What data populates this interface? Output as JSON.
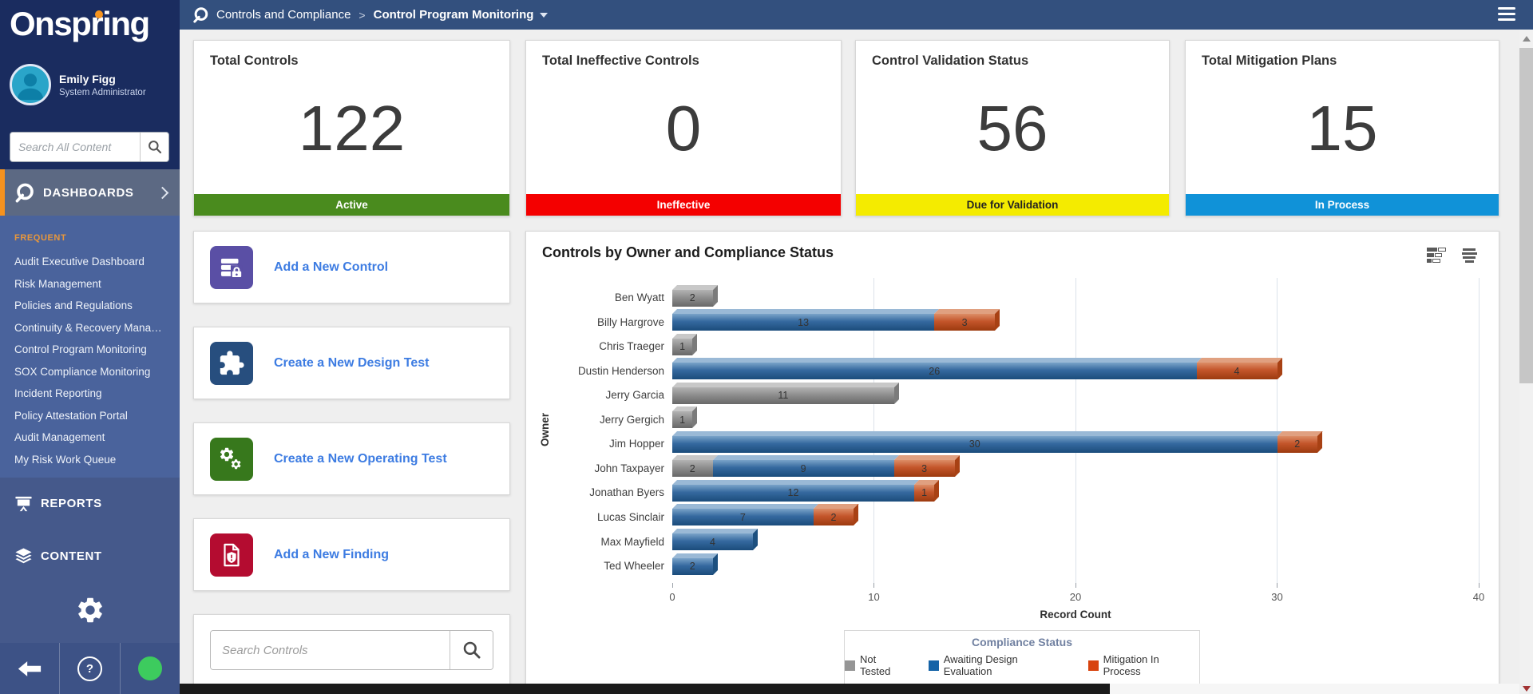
{
  "sidebar": {
    "logo": "Onspring",
    "user": {
      "name": "Emily Figg",
      "role": "System Administrator"
    },
    "search_placeholder": "Search All Content",
    "sections": {
      "dashboards": "DASHBOARDS",
      "reports": "REPORTS",
      "content": "CONTENT"
    },
    "frequent_label": "FREQUENT",
    "frequent_items": [
      "Audit Executive Dashboard",
      "Risk Management",
      "Policies and Regulations",
      "Continuity & Recovery Manag...",
      "Control Program Monitoring",
      "SOX Compliance Monitoring",
      "Incident Reporting",
      "Policy Attestation Portal",
      "Audit Management",
      "My Risk Work Queue"
    ]
  },
  "header": {
    "app": "Controls and Compliance",
    "separator": ">",
    "page": "Control Program Monitoring"
  },
  "footer": {
    "help_glyph": "?"
  },
  "kpis": [
    {
      "title": "Total Controls",
      "value": "122",
      "banner": "Active",
      "banner_color": "#4a8b1e",
      "banner_text_color": "#ffffff"
    },
    {
      "title": "Total Ineffective Controls",
      "value": "0",
      "banner": "Ineffective",
      "banner_color": "#f40000",
      "banner_text_color": "#ffffff"
    },
    {
      "title": "Control Validation Status",
      "value": "56",
      "banner": "Due for Validation",
      "banner_color": "#f4eb00",
      "banner_text_color": "#222222"
    },
    {
      "title": "Total Mitigation Plans",
      "value": "15",
      "banner": "In Process",
      "banner_color": "#1092d8",
      "banner_text_color": "#ffffff"
    }
  ],
  "quick_actions": [
    {
      "label": "Add a New Control",
      "icon": "control-stack-lock-icon",
      "tile_color": "#5a4fa5"
    },
    {
      "label": "Create a New Design Test",
      "icon": "puzzle-icon",
      "tile_color": "#274e7e"
    },
    {
      "label": "Create a New Operating Test",
      "icon": "gears-icon",
      "tile_color": "#37781c"
    },
    {
      "label": "Add a New Finding",
      "icon": "document-shield-icon",
      "tile_color": "#b40c30"
    }
  ],
  "controls_search": {
    "placeholder": "Search Controls"
  },
  "chart_data": {
    "type": "bar",
    "orientation": "horizontal",
    "stacked": true,
    "title": "Controls by Owner and Compliance Status",
    "categories": [
      "Ben Wyatt",
      "Billy Hargrove",
      "Chris Traeger",
      "Dustin Henderson",
      "Jerry Garcia",
      "Jerry Gergich",
      "Jim Hopper",
      "John Taxpayer",
      "Jonathan Byers",
      "Lucas Sinclair",
      "Max Mayfield",
      "Ted Wheeler"
    ],
    "series": [
      {
        "name": "Not Tested",
        "color": "#959595",
        "values": [
          2,
          0,
          1,
          0,
          11,
          1,
          0,
          2,
          0,
          0,
          0,
          0
        ]
      },
      {
        "name": "Awaiting Design Evaluation",
        "color": "#1563a7",
        "values": [
          0,
          13,
          0,
          26,
          0,
          0,
          30,
          9,
          12,
          7,
          4,
          2
        ]
      },
      {
        "name": "Mitigation In Process",
        "color": "#d8430e",
        "values": [
          0,
          3,
          0,
          4,
          0,
          0,
          2,
          3,
          1,
          2,
          0,
          0
        ]
      }
    ],
    "xlabel": "Record Count",
    "ylabel": "Owner",
    "xlim": [
      0,
      40
    ],
    "xticks": [
      0,
      10,
      20,
      30,
      40
    ],
    "grid": true,
    "legend_title": "Compliance Status",
    "legend_position": "bottom"
  }
}
